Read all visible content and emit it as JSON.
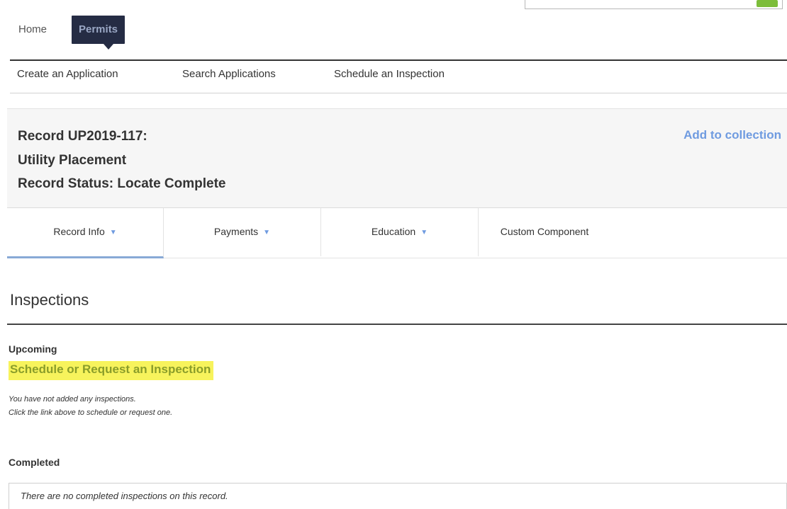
{
  "colors": {
    "nav_active_bg": "#252c44",
    "link_blue": "#6f9be0",
    "highlight_yellow": "#f7f35c",
    "search_button_green": "#7cbd3a"
  },
  "topnav": {
    "home_label": "Home",
    "permits_label": "Permits"
  },
  "subnav": {
    "items": [
      "Create an Application",
      "Search Applications",
      "Schedule an Inspection"
    ]
  },
  "record": {
    "id_line": "Record UP2019-117:",
    "type_line": "Utility Placement",
    "status_line": "Record Status: Locate Complete",
    "add_to_collection": "Add to collection"
  },
  "tabs": [
    {
      "label": "Record Info",
      "dropdown": true,
      "active": true
    },
    {
      "label": "Payments",
      "dropdown": true,
      "active": false
    },
    {
      "label": "Education",
      "dropdown": true,
      "active": false
    },
    {
      "label": "Custom Component",
      "dropdown": false,
      "active": false
    }
  ],
  "inspections": {
    "title": "Inspections",
    "upcoming_label": "Upcoming",
    "schedule_link": "Schedule or Request an Inspection",
    "empty_note_1": "You have not added any inspections.",
    "empty_note_2": "Click the link above to schedule or request one.",
    "completed_label": "Completed",
    "completed_empty": "There are no completed inspections on this record."
  }
}
